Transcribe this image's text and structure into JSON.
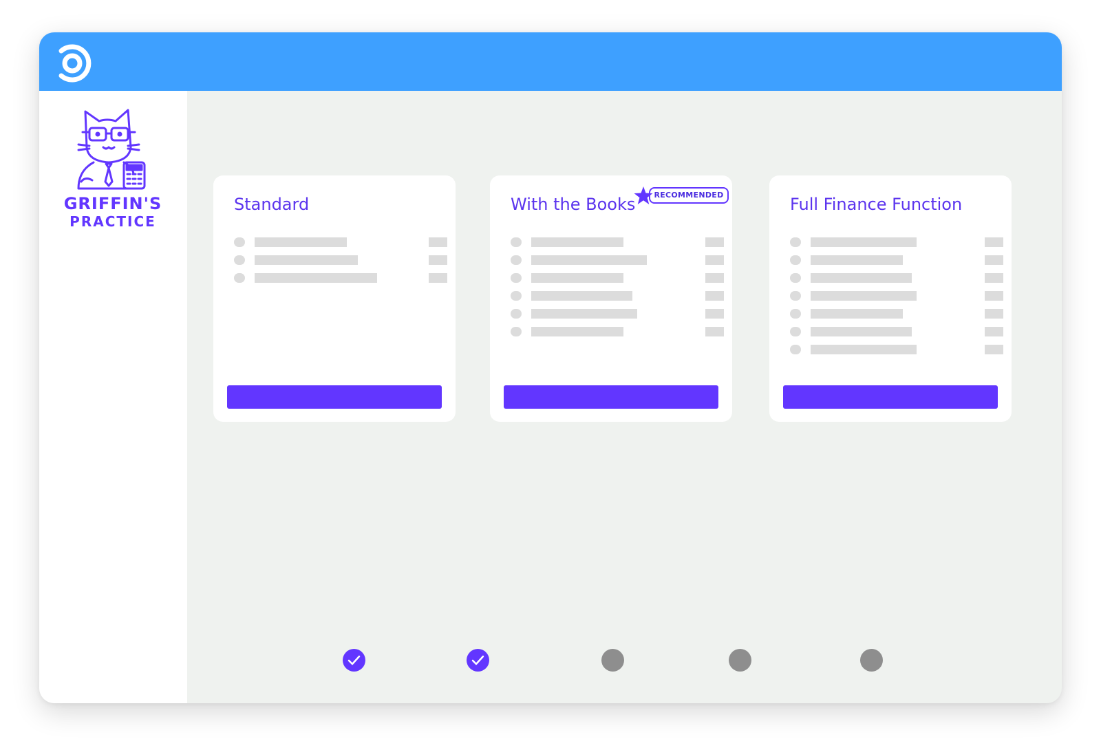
{
  "brand": {
    "name_line1": "GRIFFIN'S",
    "name_line2": "PRACTICE",
    "accent_color": "#6236ff",
    "topbar_color": "#3ea0ff"
  },
  "app_logo_icon": "circular-o-logo",
  "plans": [
    {
      "title": "Standard",
      "recommended": false,
      "feature_rows": 3
    },
    {
      "title": "With the Books",
      "recommended": true,
      "badge_label": "RECOMMENDED",
      "feature_rows": 6
    },
    {
      "title": "Full Finance Function",
      "recommended": false,
      "feature_rows": 7
    }
  ],
  "steps": [
    {
      "state": "complete",
      "icon": "check-icon"
    },
    {
      "state": "complete",
      "icon": "check-icon"
    },
    {
      "state": "pending"
    },
    {
      "state": "pending"
    },
    {
      "state": "pending"
    }
  ]
}
